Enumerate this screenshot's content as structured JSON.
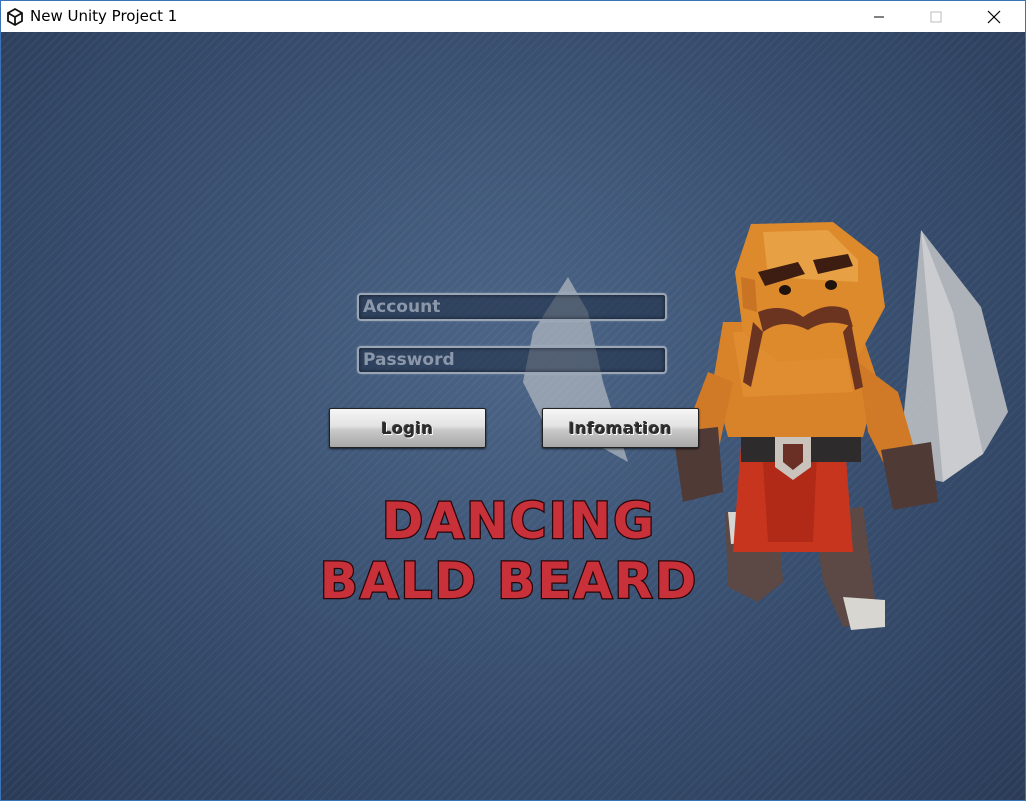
{
  "window": {
    "title": "New Unity Project 1",
    "app_icon": "unity-icon",
    "controls": [
      "minimize-icon",
      "maximize-icon",
      "close-icon"
    ]
  },
  "login_form": {
    "account_placeholder": "Account",
    "account_value": "",
    "password_placeholder": "Password",
    "password_value": "",
    "login_label": "Login",
    "info_label": "Infomation"
  },
  "logo": {
    "line1": "DANCING",
    "line2": "BALD BEARD",
    "color": "#c8313a"
  },
  "colors": {
    "background": "#3a5172",
    "titlebar": "#ffffff",
    "window_border": "#3b73b9"
  }
}
